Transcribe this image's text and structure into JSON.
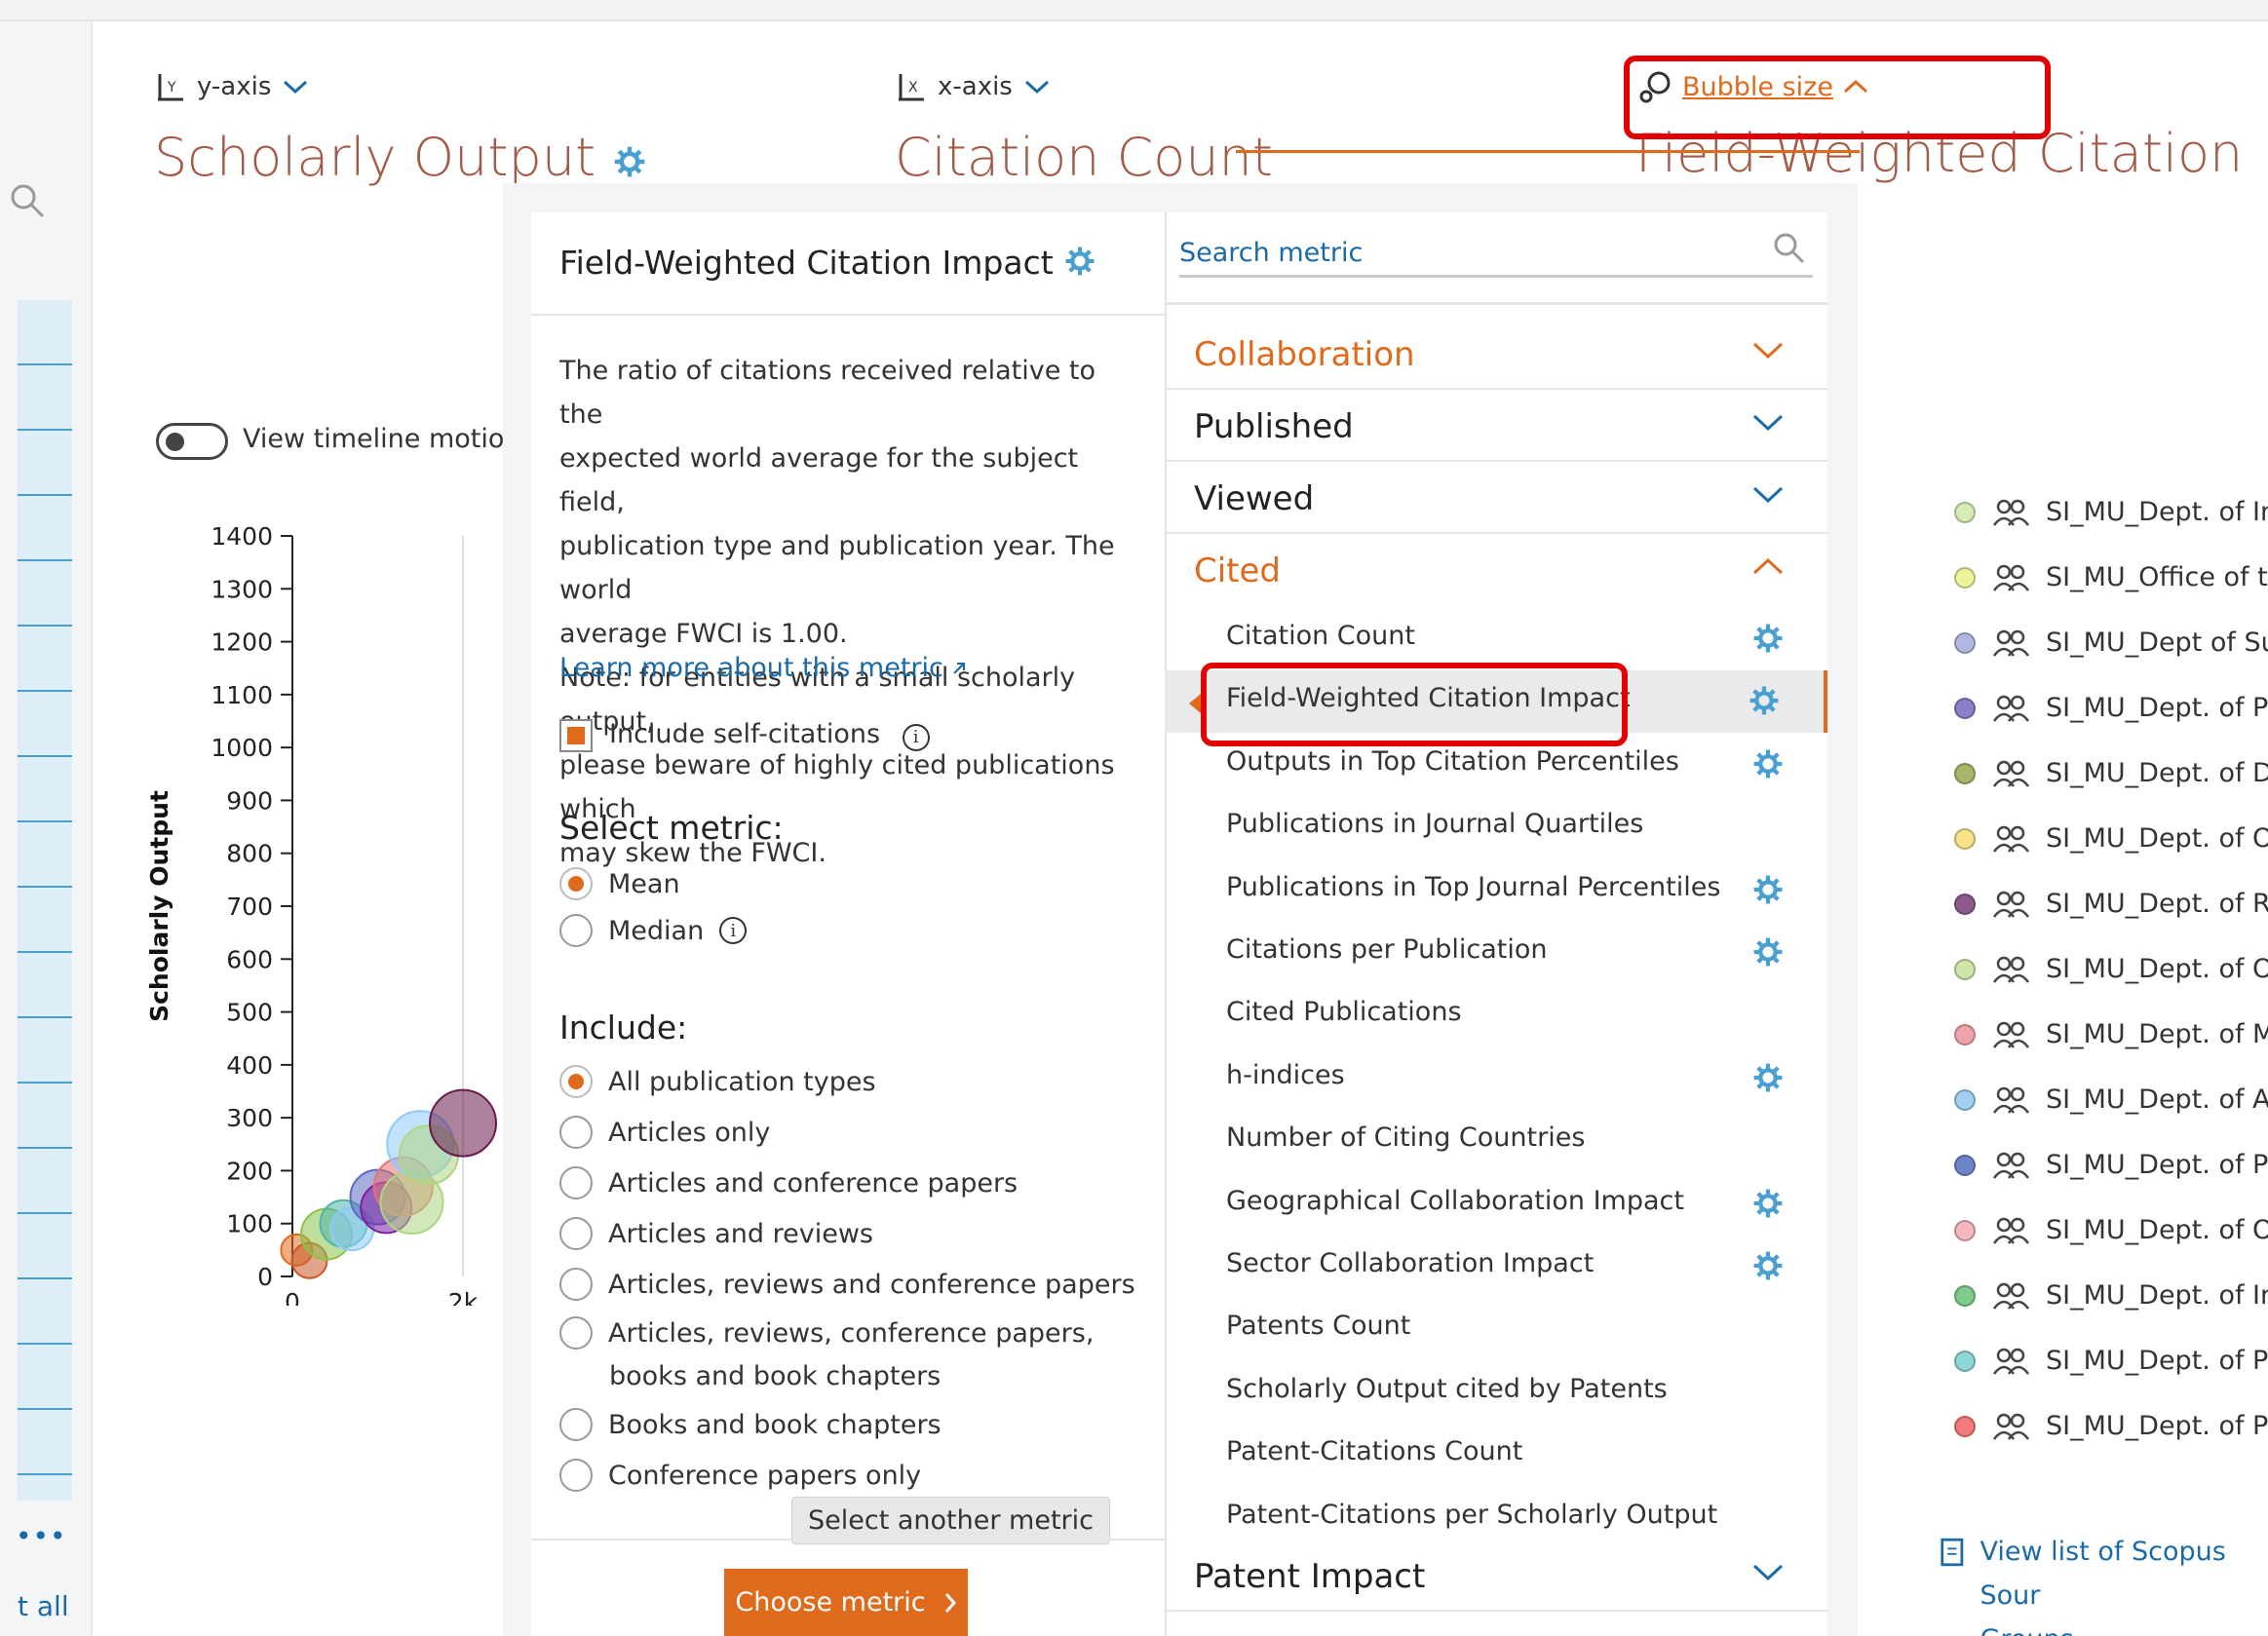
{
  "rail": {
    "more_label": "•••",
    "all_label": "t all"
  },
  "axes": {
    "y": {
      "selector_label": "y-axis",
      "title": "Scholarly Output"
    },
    "x": {
      "selector_label": "x-axis",
      "title": "Citation Count"
    },
    "bubble": {
      "selector_label": "Bubble size",
      "title": "Field-Weighted Citation"
    }
  },
  "toggle": {
    "label": "View timeline motion ch"
  },
  "chart_data": {
    "type": "scatter",
    "ylabel": "Scholarly Output",
    "ylim": [
      0,
      1400
    ],
    "y_ticks": [
      "1400",
      "1300",
      "1200",
      "1100",
      "1000",
      "900",
      "800",
      "700",
      "600",
      "500",
      "400",
      "300",
      "200",
      "100",
      "0"
    ],
    "x_ticks": [
      "0",
      "2k"
    ],
    "grid": true,
    "points": [
      {
        "x": 50,
        "y": 50,
        "color": "#e06a1b"
      },
      {
        "x": 200,
        "y": 30,
        "color": "#c85a2a"
      },
      {
        "x": 400,
        "y": 80,
        "color": "#8bc34a"
      },
      {
        "x": 600,
        "y": 100,
        "color": "#4db6ac"
      },
      {
        "x": 700,
        "y": 90,
        "color": "#90caf9"
      },
      {
        "x": 1000,
        "y": 150,
        "color": "#5c6bc0"
      },
      {
        "x": 1100,
        "y": 130,
        "color": "#7b1fa2"
      },
      {
        "x": 1300,
        "y": 170,
        "color": "#e57373"
      },
      {
        "x": 1400,
        "y": 140,
        "color": "#aed581"
      },
      {
        "x": 1500,
        "y": 250,
        "color": "#90caf9"
      },
      {
        "x": 1600,
        "y": 230,
        "color": "#aed581"
      },
      {
        "x": 2000,
        "y": 290,
        "color": "#6a1b4d"
      }
    ]
  },
  "detail": {
    "title": "Field-Weighted Citation Impact",
    "description_lines": [
      "The ratio of citations received relative to the",
      "expected world average for the subject field,",
      "publication type and publication year. The world",
      "average FWCI is 1.00.",
      "Note: for entities with a small scholarly output,",
      "please beware of highly cited publications which",
      "may skew the FWCI."
    ],
    "learn_more": "Learn more about this metric",
    "self_citations_label": "Include self-citations",
    "select_metric_heading": "Select metric:",
    "metric_options": [
      "Mean",
      "Median"
    ],
    "selected_metric": "Mean",
    "include_heading": "Include:",
    "include_options": [
      "All publication types",
      "Articles only",
      "Articles and conference papers",
      "Articles and reviews",
      "Articles, reviews and conference papers",
      "Articles, reviews, conference papers,",
      "Books and book chapters",
      "Conference papers only"
    ],
    "include_option_6_cont": "books and book chapters",
    "selected_include": "All publication types",
    "tooltip": "Select another metric",
    "choose_button": "Choose metric"
  },
  "metric_list": {
    "search_placeholder": "Search metric",
    "categories": [
      {
        "label": "Collaboration",
        "expanded": false,
        "highlight": true
      },
      {
        "label": "Published",
        "expanded": false,
        "highlight": false
      },
      {
        "label": "Viewed",
        "expanded": false,
        "highlight": false
      },
      {
        "label": "Cited",
        "expanded": true,
        "highlight": true
      },
      {
        "label": "Patent Impact",
        "expanded": false,
        "highlight": false
      }
    ],
    "cited_metrics": [
      {
        "label": "Citation Count",
        "snowball": true
      },
      {
        "label": "Field-Weighted Citation Impact",
        "snowball": true,
        "selected": true
      },
      {
        "label": "Outputs in Top Citation Percentiles",
        "snowball": true
      },
      {
        "label": "Publications in Journal Quartiles",
        "snowball": false
      },
      {
        "label": "Publications in Top Journal Percentiles",
        "snowball": true
      },
      {
        "label": "Citations per Publication",
        "snowball": true
      },
      {
        "label": "Cited Publications",
        "snowball": false
      },
      {
        "label": "h-indices",
        "snowball": true
      },
      {
        "label": "Number of Citing Countries",
        "snowball": false
      },
      {
        "label": "Geographical Collaboration Impact",
        "snowball": true
      },
      {
        "label": "Sector Collaboration Impact",
        "snowball": true
      },
      {
        "label": "Patents Count",
        "snowball": false
      },
      {
        "label": "Scholarly Output cited by Patents",
        "snowball": false
      },
      {
        "label": "Patent-Citations Count",
        "snowball": false
      },
      {
        "label": "Patent-Citations per Scholarly Output",
        "snowball": false
      }
    ]
  },
  "legend": [
    {
      "label": "SI_MU_Dept. of Int",
      "color": "#d7ecb4"
    },
    {
      "label": "SI_MU_Office of th",
      "color": "#eef29a"
    },
    {
      "label": "SI_MU_Dept of Sur",
      "color": "#b3b8e0"
    },
    {
      "label": "SI_MU_Dept. of Pe",
      "color": "#8b80c8"
    },
    {
      "label": "SI_MU_Dept. of De",
      "color": "#a6b86a"
    },
    {
      "label": "SI_MU_Dept. of Ol",
      "color": "#f7e38a"
    },
    {
      "label": "SI_MU_Dept. of Ra",
      "color": "#8e5a8e"
    },
    {
      "label": "SI_MU_Dept. of Or",
      "color": "#cfe6a8"
    },
    {
      "label": "SI_MU_Dept. of M",
      "color": "#f2a3ad"
    },
    {
      "label": "SI_MU_Dept. of Ar",
      "color": "#9fd0f2"
    },
    {
      "label": "SI_MU_Dept. of Pa",
      "color": "#6b86c8"
    },
    {
      "label": "SI_MU_Dept. of Op",
      "color": "#f5b6bd"
    },
    {
      "label": "SI_MU_Dept. of Im",
      "color": "#7ecb8a"
    },
    {
      "label": "SI_MU_Dept. of Ps",
      "color": "#8fd8d4"
    },
    {
      "label": "SI_MU_Dept. of Pa",
      "color": "#f27a7a"
    }
  ],
  "view_list": {
    "line1": "View list of Scopus Sour",
    "line2": "Groups"
  },
  "colors": {
    "accent": "#e06a1b",
    "link": "#1a6aa8",
    "title": "#a35a47",
    "snowball": "#4a9fd1",
    "highlight_box": "#e30000"
  }
}
